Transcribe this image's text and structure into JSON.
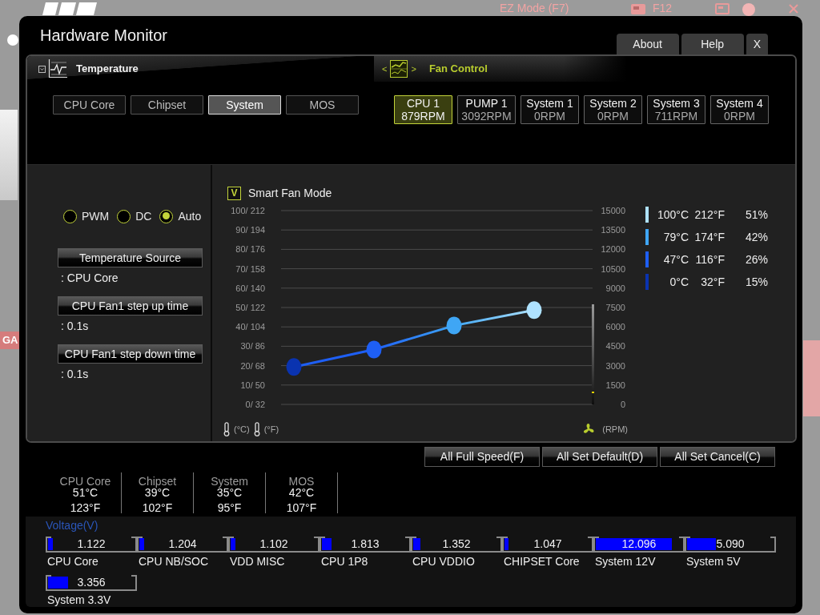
{
  "background": {
    "mode_label": "EZ Mode (F7)",
    "key_label": "F12",
    "side_label": "GA"
  },
  "window": {
    "title": "Hardware Monitor",
    "buttons": [
      "About",
      "Help",
      "X"
    ]
  },
  "temperature": {
    "title": "Temperature",
    "tabs": [
      {
        "label": "CPU Core",
        "selected": false
      },
      {
        "label": "Chipset",
        "selected": false
      },
      {
        "label": "System",
        "selected": true
      },
      {
        "label": "MOS",
        "selected": false
      }
    ]
  },
  "fan_control": {
    "prev_glyph": "<",
    "next_glyph": ">",
    "title": "Fan Control",
    "fans": [
      {
        "name": "CPU 1",
        "speed": "879RPM",
        "selected": true
      },
      {
        "name": "PUMP 1",
        "speed": "3092RPM",
        "selected": false
      },
      {
        "name": "System 1",
        "speed": "0RPM",
        "selected": false
      },
      {
        "name": "System 2",
        "speed": "0RPM",
        "selected": false
      },
      {
        "name": "System 3",
        "speed": "711RPM",
        "selected": false
      },
      {
        "name": "System 4",
        "speed": "0RPM",
        "selected": false
      }
    ]
  },
  "fan_mode": {
    "options": [
      {
        "label": "PWM",
        "selected": false
      },
      {
        "label": "DC",
        "selected": false
      },
      {
        "label": "Auto",
        "selected": true
      }
    ]
  },
  "settings": [
    {
      "button": "Temperature Source",
      "value": ": CPU Core"
    },
    {
      "button": "CPU Fan1 step up time",
      "value": ": 0.1s"
    },
    {
      "button": "CPU Fan1 step down time",
      "value": ": 0.1s"
    }
  ],
  "smart_fan": {
    "label": "Smart Fan Mode",
    "checked": true,
    "check_glyph": "V"
  },
  "fan_curve": {
    "chart_data": {
      "type": "line",
      "categories": [
        null,
        null,
        null,
        null
      ],
      "values": [
        2900,
        4250,
        6100,
        7300
      ],
      "ylim": [
        0,
        15000
      ],
      "yticks": [
        15000,
        13500,
        12000,
        10500,
        9000,
        7500,
        6000,
        4500,
        3000,
        1500,
        0
      ],
      "grid": true,
      "marker": "circle"
    },
    "left_ticks": [
      "100/ 212",
      "90/ 194",
      "80/ 176",
      "70/ 158",
      "60/ 140",
      "50/ 122",
      "40/ 104",
      "30/ 86",
      "20/ 68",
      "10/ 50",
      "0/ 32"
    ],
    "rpm_meter": {
      "level": 0.12
    },
    "units": {
      "celsius": "(°C)",
      "fahrenheit": "(°F)",
      "rpm": "(RPM)"
    },
    "setpoints": [
      {
        "temp_c": "100°C",
        "temp_f": "212°F",
        "duty": "51%",
        "color": "#aee2ff"
      },
      {
        "temp_c": "79°C",
        "temp_f": "174°F",
        "duty": "42%",
        "color": "#3fa6f5"
      },
      {
        "temp_c": "47°C",
        "temp_f": "116°F",
        "duty": "26%",
        "color": "#1e5ff5"
      },
      {
        "temp_c": "0°C",
        "temp_f": "32°F",
        "duty": "15%",
        "color": "#0a33b0"
      }
    ]
  },
  "actions": [
    "All Full Speed(F)",
    "All Set Default(D)",
    "All Set Cancel(C)"
  ],
  "temperature_readings": [
    {
      "name": "CPU Core",
      "celsius": "51°C",
      "fahrenheit": "123°F"
    },
    {
      "name": "Chipset",
      "celsius": "39°C",
      "fahrenheit": "102°F"
    },
    {
      "name": "System",
      "celsius": "35°C",
      "fahrenheit": "95°F"
    },
    {
      "name": "MOS",
      "celsius": "42°C",
      "fahrenheit": "107°F"
    }
  ],
  "voltage": {
    "title": "Voltage(V)",
    "meters": [
      {
        "name": "CPU Core",
        "reading": "1.122",
        "level": 0.06
      },
      {
        "name": "CPU NB/SOC",
        "reading": "1.204",
        "level": 0.06
      },
      {
        "name": "VDD MISC",
        "reading": "1.102",
        "level": 0.06
      },
      {
        "name": "CPU 1P8",
        "reading": "1.813",
        "level": 0.11
      },
      {
        "name": "CPU VDDIO",
        "reading": "1.352",
        "level": 0.08
      },
      {
        "name": "CHIPSET Core",
        "reading": "1.047",
        "level": 0.05
      },
      {
        "name": "System 12V",
        "reading": "12.096",
        "level": 0.88
      },
      {
        "name": "System 5V",
        "reading": "5.090",
        "level": 0.33
      },
      {
        "name": "System 3.3V",
        "reading": "3.356",
        "level": 0.23
      }
    ]
  }
}
